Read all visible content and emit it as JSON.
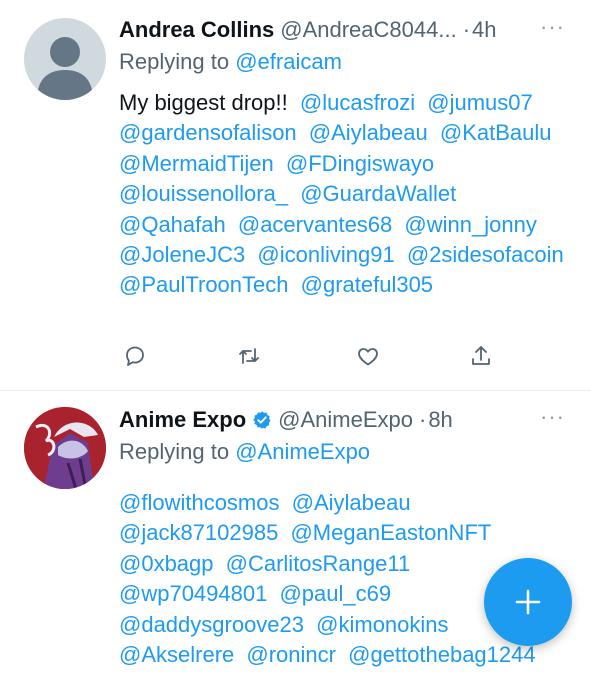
{
  "tweets": [
    {
      "author_name": "Andrea Collins",
      "handle": "@AndreaC8044...",
      "separator": "·",
      "time": "4h",
      "reply_prefix": "Replying to",
      "reply_to": "@efraicam",
      "text_intro": "My biggest drop!!",
      "mentions": [
        "@lucasfrozi",
        "@jumus07",
        "@gardensofalison",
        "@Aiylabeau",
        "@KatBaulu",
        "@MermaidTijen",
        "@FDingiswayo",
        "@louissenollora_",
        "@GuardaWallet",
        "@Qahafah",
        "@acervantes68",
        "@winn_jonny",
        "@JoleneJC3",
        "@iconliving91",
        "@2sidesofacoin",
        "@PaulTroonTech",
        "@grateful305"
      ],
      "avatar_icon": "default-avatar-icon"
    },
    {
      "author_name": "Anime Expo",
      "verified_icon": "verified-badge-icon",
      "handle": "@AnimeExpo",
      "separator": "·",
      "time": "8h",
      "reply_prefix": "Replying to",
      "reply_to": "@AnimeExpo",
      "mentions": [
        "@flowithcosmos",
        "@Aiylabeau",
        "@jack87102985",
        "@MeganEastonNFT",
        "@0xbagp",
        "@CarlitosRange11",
        "@wp70494801",
        "@paul_c69",
        "@daddysgroove23",
        "@kimonokins",
        "@Akselrere",
        "@ronincr",
        "@gettothebag1244"
      ]
    }
  ],
  "actions": {
    "icons": [
      "reply-icon",
      "retweet-icon",
      "like-icon",
      "share-icon"
    ]
  },
  "fab_icon": "compose-plus-icon",
  "colors": {
    "link": "#1d9bf0",
    "muted": "#536471",
    "fab": "#1d9bf0",
    "divider": "#e6ecf0"
  }
}
